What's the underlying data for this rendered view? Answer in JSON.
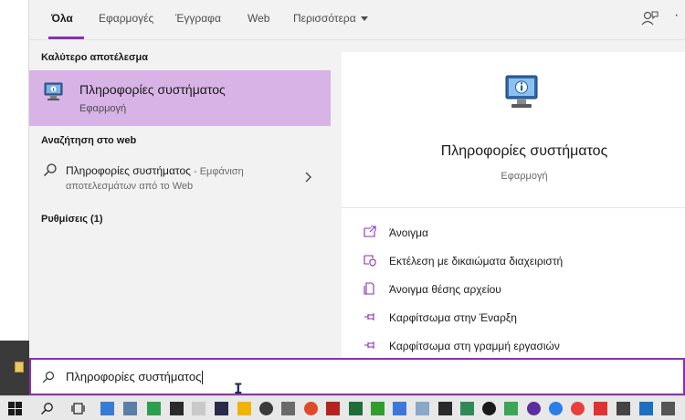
{
  "tabs": [
    {
      "label": "Όλα",
      "active": true
    },
    {
      "label": "Εφαρμογές"
    },
    {
      "label": "Έγγραφα"
    },
    {
      "label": "Web"
    },
    {
      "label": "Περισσότερα"
    }
  ],
  "accent_color": "#8b2fb3",
  "highlight_color": "#d7b3e6",
  "left": {
    "best_header": "Καλύτερο αποτέλεσμα",
    "best": {
      "title": "Πληροφορίες συστήματος",
      "subtitle": "Εφαρμογή",
      "icon": "system-information-icon"
    },
    "web_header": "Αναζήτηση στο web",
    "web": {
      "query": "Πληροφορίες συστήματος",
      "hint": " - Εμφάνιση",
      "second_line": "αποτελεσμάτων από το Web"
    },
    "settings_header": "Ρυθμίσεις (1)"
  },
  "preview": {
    "title": "Πληροφορίες συστήματος",
    "subtitle": "Εφαρμογή",
    "actions": [
      {
        "label": "Άνοιγμα",
        "icon": "open-icon"
      },
      {
        "label": "Εκτέλεση με δικαιώματα διαχειριστή",
        "icon": "run-as-admin-icon"
      },
      {
        "label": "Άνοιγμα θέσης αρχείου",
        "icon": "file-location-icon"
      },
      {
        "label": "Καρφίτσωμα στην Έναρξη",
        "icon": "pin-icon"
      },
      {
        "label": "Καρφίτσωμα στη γραμμή εργασιών",
        "icon": "pin-icon"
      }
    ]
  },
  "search": {
    "value": "Πληροφορίες συστήματος"
  }
}
